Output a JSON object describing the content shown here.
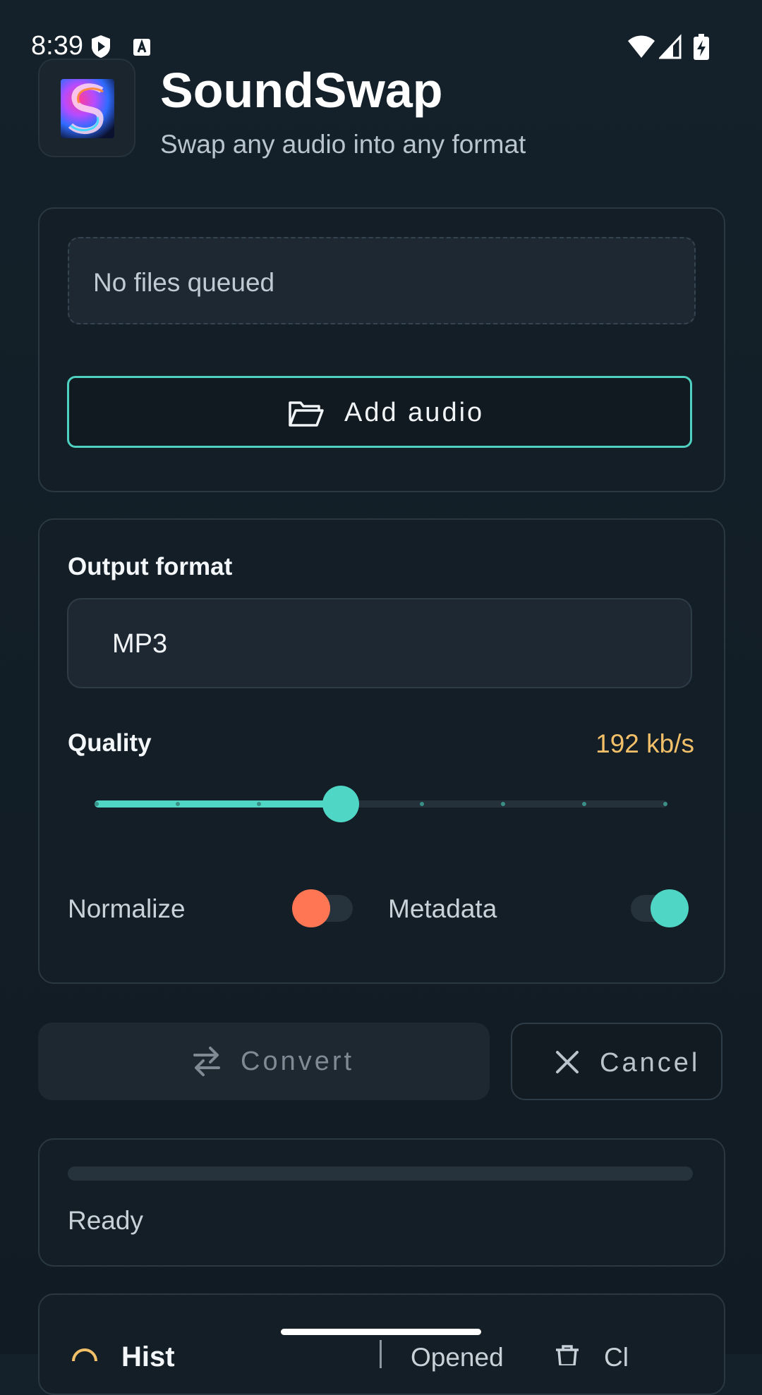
{
  "status_bar": {
    "time": "8:39"
  },
  "header": {
    "title": "SoundSwap",
    "subtitle": "Swap any audio into any format"
  },
  "queue": {
    "empty_text": "No files queued",
    "add_button_label": "Add audio"
  },
  "settings": {
    "format_label": "Output format",
    "format_value": "MP3",
    "quality_label": "Quality",
    "quality_value": "192 kb/s",
    "quality_slider_fraction": 0.43,
    "normalize_label": "Normalize",
    "normalize_on": false,
    "metadata_label": "Metadata",
    "metadata_on": true
  },
  "actions": {
    "convert_label": "Convert",
    "cancel_label": "Cancel"
  },
  "progress": {
    "status_text": "Ready",
    "fraction": 0
  },
  "history": {
    "title": "Hist",
    "col_label": "Opened",
    "clear_label": "Cl"
  },
  "colors": {
    "accent": "#4fd6c4",
    "warning": "#f2c069",
    "toggle_off": "#ff7654"
  }
}
